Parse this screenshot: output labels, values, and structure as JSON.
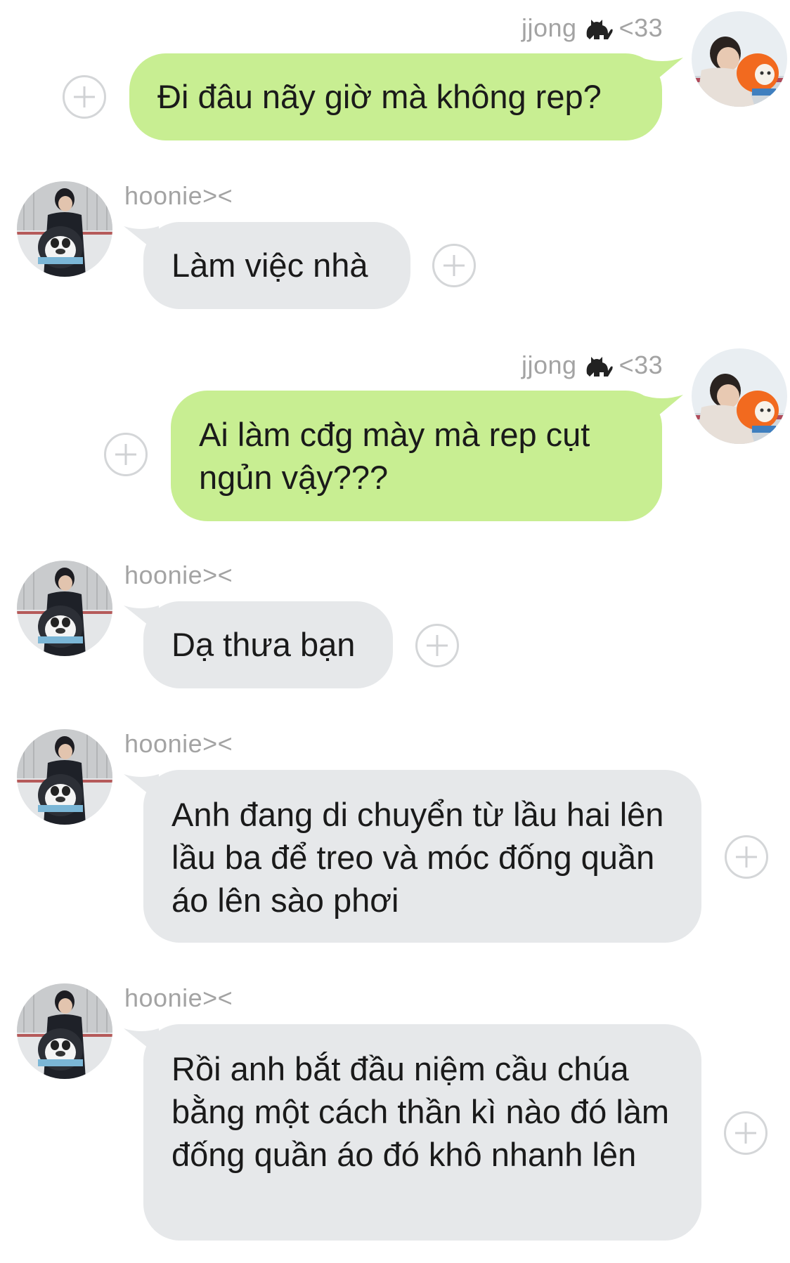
{
  "outgoing_sender": {
    "name": "jjong",
    "suffix": "<33",
    "icon": "cat-icon"
  },
  "incoming_sender": {
    "name": "hoonie><"
  },
  "messages": [
    {
      "direction": "outgoing",
      "text": "Đi đâu nãy giờ mà không rep?"
    },
    {
      "direction": "incoming",
      "text": "Làm việc nhà"
    },
    {
      "direction": "outgoing",
      "text": "Ai làm cđg mày mà rep cụt ngủn vậy???"
    },
    {
      "direction": "incoming",
      "text": "Dạ thưa bạn"
    },
    {
      "direction": "incoming",
      "text": "Anh đang di chuyển từ lầu hai lên lầu ba để treo và móc đống quần áo lên sào phơi"
    },
    {
      "direction": "incoming",
      "text": "Rồi anh bắt đầu niệm cầu chúa bằng một cách thần kì nào đó làm đống quần áo đó khô nhanh lên"
    }
  ],
  "colors": {
    "outgoing_bubble": "#c8ee92",
    "incoming_bubble": "#e6e8ea",
    "sender_name": "#a3a3a3",
    "background": "#ffffff"
  }
}
